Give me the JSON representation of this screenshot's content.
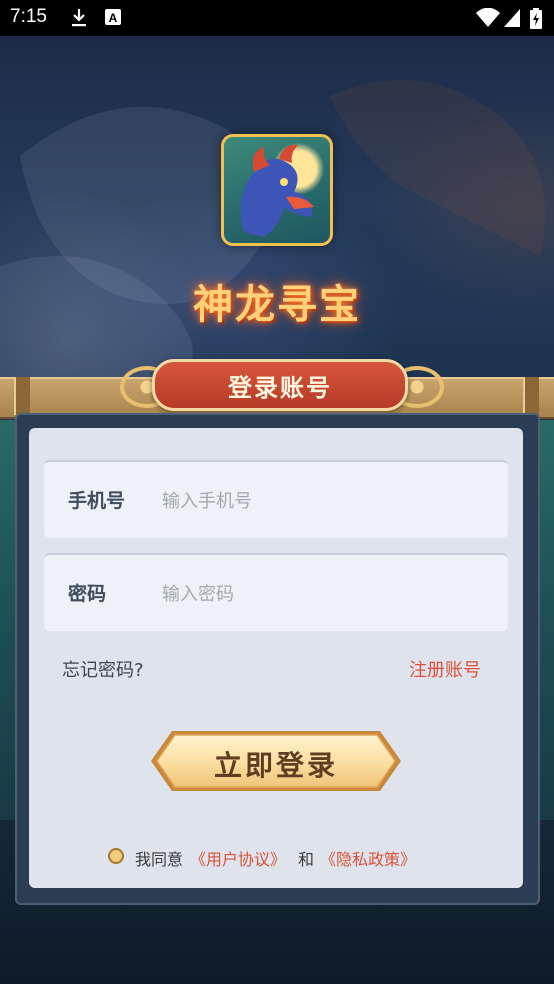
{
  "status_bar": {
    "time": "7:15",
    "icons": [
      "download-icon",
      "a-notification-icon",
      "wifi-icon",
      "signal-icon",
      "battery-charging-icon"
    ]
  },
  "app": {
    "title": "神龙寻宝",
    "icon": "dragon-app-icon"
  },
  "banner": {
    "title": "登录账号"
  },
  "form": {
    "phone": {
      "label": "手机号",
      "placeholder": "输入手机号",
      "value": ""
    },
    "password": {
      "label": "密码",
      "placeholder": "输入密码",
      "value": ""
    },
    "forgot_label": "忘记密码?",
    "register_label": "注册账号",
    "login_label": "立即登录"
  },
  "agreement": {
    "prefix": "我同意",
    "terms_link": "《用户协议》",
    "and": "和",
    "privacy_link": "《隐私政策》",
    "checked": false
  },
  "colors": {
    "accent_red": "#d9533a",
    "gold": "#f1c04e",
    "card_bg": "#dfe4ec"
  }
}
